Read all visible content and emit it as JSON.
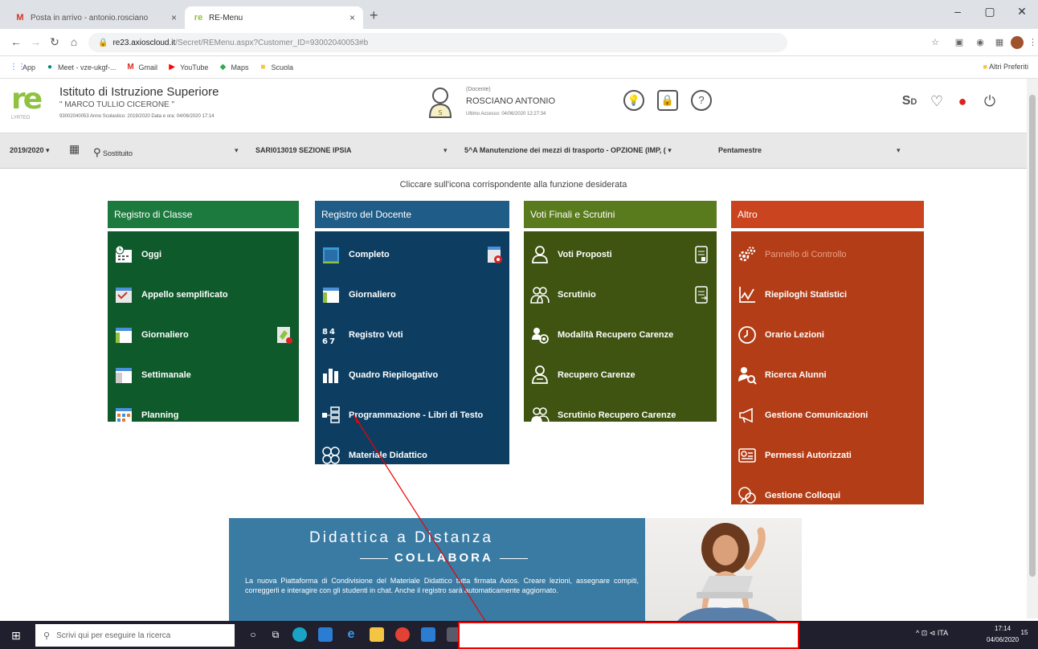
{
  "browser": {
    "tabs": [
      {
        "title": "Posta in arrivo - antonio.rosciano",
        "icon": "gmail-icon",
        "active": false
      },
      {
        "title": "RE-Menu",
        "icon": "axios-icon",
        "active": true
      }
    ],
    "new_tab": "+",
    "url_host": "re23.axioscloud.it",
    "url_path": "/Secret/REMenu.aspx?Customer_ID=93002040053#b",
    "bookmarks": [
      {
        "label": "App",
        "icon": "apps-grid-icon"
      },
      {
        "label": "Meet - vze-ukgf-...",
        "icon": "meet-icon"
      },
      {
        "label": "Gmail",
        "icon": "gmail-icon"
      },
      {
        "label": "YouTube",
        "icon": "youtube-icon"
      },
      {
        "label": "Maps",
        "icon": "maps-icon"
      },
      {
        "label": "Scuola",
        "icon": "folder-icon"
      }
    ],
    "bookmarks_other": "Altri Preferiti"
  },
  "header": {
    "logo": "re",
    "logo_sub": "LYRTEO",
    "school_line1": "Istituto di Istruzione Superiore",
    "school_line2": "\" MARCO TULLIO CICERONE \"",
    "school_line3": "93002040053    Anno Scolastico: 2019/2020    Data e ora: 04/06/2020 17:14",
    "user_role": "(Docente)",
    "user_name": "ROSCIANO ANTONIO",
    "user_last_access": "Ultimo Accesso: 04/06/2020 12:27:34"
  },
  "filterbar": {
    "year": "2019/2020",
    "substitute": "Sostituito",
    "school": "SARI013019 SEZIONE IPSIA",
    "class": "5^A Manutenzione dei mezzi di trasporto - OPZIONE (IMP, (",
    "period": "Pentamestre"
  },
  "instruction": "Cliccare sull'icona corrispondente alla funzione desiderata",
  "panels": {
    "classe": {
      "title": "Registro di Classe",
      "head_color": "#1d7a3f",
      "body_color": "#0e5a2a",
      "items": [
        "Oggi",
        "Appello semplificato",
        "Giornaliero",
        "Settimanale",
        "Planning"
      ]
    },
    "docente": {
      "title": "Registro del Docente",
      "head_color": "#1f5c87",
      "body_color": "#0d3e62",
      "items": [
        "Completo",
        "Giornaliero",
        "Registro Voti",
        "Quadro Riepilogativo",
        "Programmazione - Libri di Testo",
        "Materiale Didattico"
      ]
    },
    "voti": {
      "title": "Voti Finali e Scrutini",
      "head_color": "#5a7a1e",
      "body_color": "#3e5410",
      "items": [
        "Voti Proposti",
        "Scrutinio",
        "Modalità Recupero Carenze",
        "Recupero Carenze",
        "Scrutinio Recupero Carenze"
      ]
    },
    "altro": {
      "title": "Altro",
      "head_color": "#c9441f",
      "body_color": "#b33d16",
      "items": [
        "Pannello di Controllo",
        "Riepiloghi Statistici",
        "Orario Lezioni",
        "Ricerca Alunni",
        "Gestione Comunicazioni",
        "Permessi Autorizzati",
        "Gestione Colloqui"
      ]
    }
  },
  "banner": {
    "title": "Didattica a Distanza",
    "brand": "COLLABORA",
    "text": "La nuova Piattaforma di Condivisione del Materiale Didattico tutta firmata Axios. Creare lezioni, assegnare compiti, correggerli e interagire con gli studenti in chat. Anche il registro sarà automaticamente aggiornato."
  },
  "taskbar": {
    "search_placeholder": "Scrivi qui per eseguire la ricerca",
    "tray": "^  ⊡  ⊲  ITA",
    "time": "17:14",
    "date": "04/06/2020",
    "notifications": "15"
  }
}
